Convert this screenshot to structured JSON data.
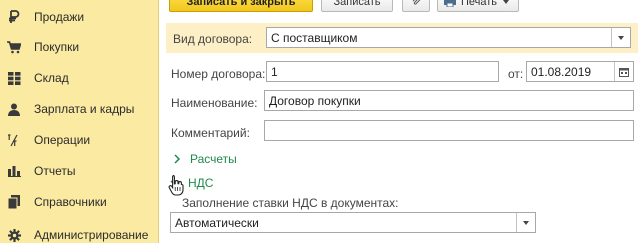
{
  "sidebar": {
    "items": [
      {
        "label": "Продажи",
        "icon": "ruble-icon"
      },
      {
        "label": "Покупки",
        "icon": "cart-icon"
      },
      {
        "label": "Склад",
        "icon": "warehouse-grid-icon"
      },
      {
        "label": "Зарплата и кадры",
        "icon": "person-icon"
      },
      {
        "label": "Операции",
        "icon": "debit-credit-icon"
      },
      {
        "label": "Отчеты",
        "icon": "bar-chart-icon"
      },
      {
        "label": "Справочники",
        "icon": "books-icon"
      },
      {
        "label": "Администрирование",
        "icon": "gear-icon"
      }
    ]
  },
  "toolbar": {
    "save_close_label": "Записать и закрыть",
    "save_label": "Записать",
    "print_label": "Печать"
  },
  "form": {
    "contract_type_label": "Вид договора:",
    "contract_type_value": "С поставщиком",
    "number_label": "Номер договора:",
    "number_value": "1",
    "date_label": "от:",
    "date_value": "01.08.2019",
    "name_label": "Наименование:",
    "name_value": "Договор покупки",
    "comment_label": "Комментарий:",
    "comment_value": "",
    "settlements_label": "Расчеты",
    "vat_label": "НДС",
    "vat_fill_label": "Заполнение ставки НДС в документах:",
    "vat_fill_value": "Автоматически"
  },
  "colors": {
    "sidebar_bg": "#fbeaa2",
    "primary_button": "#f3c61f",
    "highlight_row": "#fdf0c6",
    "link_green": "#1f8a4c"
  }
}
